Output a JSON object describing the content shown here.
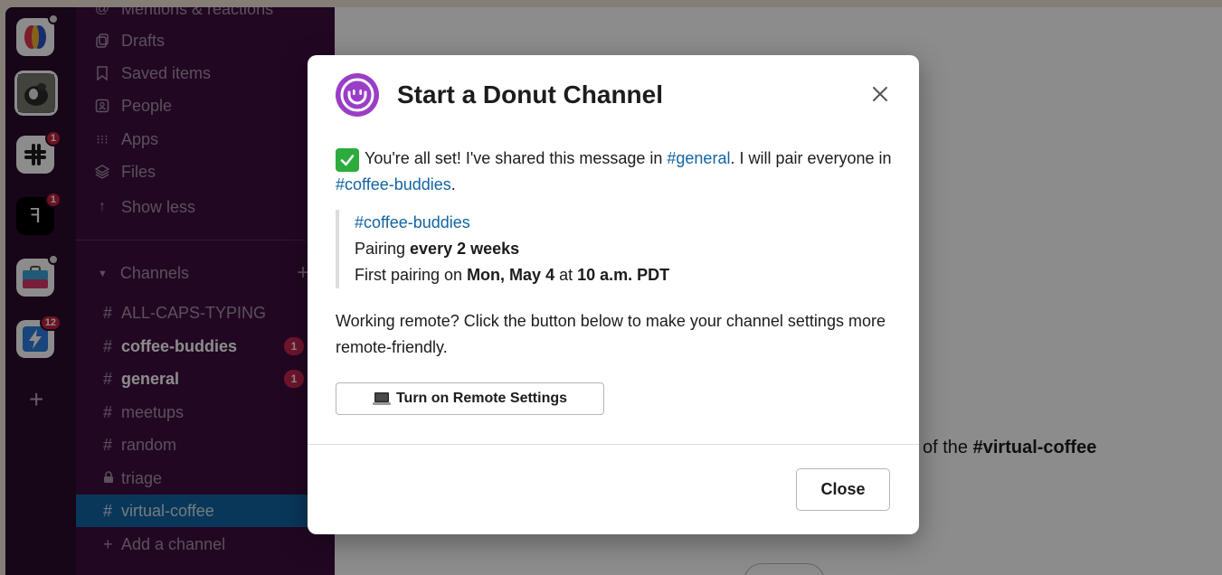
{
  "rail": {
    "workspaces": [
      {
        "name": "workspace-1",
        "badge": ""
      },
      {
        "name": "workspace-2",
        "badge": ""
      },
      {
        "name": "slack",
        "badge": "1"
      },
      {
        "name": "figma",
        "badge": "1"
      },
      {
        "name": "toolbox",
        "badge": ""
      },
      {
        "name": "bolt",
        "badge": "12"
      }
    ],
    "add_icon": "plus-icon"
  },
  "sidebar": {
    "nav": [
      {
        "label": "Mentions & reactions",
        "icon": "at-icon"
      },
      {
        "label": "Drafts",
        "icon": "drafts-icon"
      },
      {
        "label": "Saved items",
        "icon": "bookmark-icon"
      },
      {
        "label": "People",
        "icon": "people-icon"
      },
      {
        "label": "Apps",
        "icon": "apps-icon"
      },
      {
        "label": "Files",
        "icon": "files-icon"
      },
      {
        "label": "Show less",
        "icon": "arrow-up-icon"
      }
    ],
    "channels_label": "Channels",
    "channels": [
      {
        "prefix": "#",
        "name": "ALL-CAPS-TYPING",
        "badge": ""
      },
      {
        "prefix": "#",
        "name": "coffee-buddies",
        "badge": "1"
      },
      {
        "prefix": "#",
        "name": "general",
        "badge": "1"
      },
      {
        "prefix": "#",
        "name": "meetups",
        "badge": ""
      },
      {
        "prefix": "#",
        "name": "random",
        "badge": ""
      },
      {
        "prefix": "lock",
        "name": "triage",
        "badge": ""
      },
      {
        "prefix": "#",
        "name": "virtual-coffee",
        "badge": ""
      }
    ],
    "add_channel": "Add a channel"
  },
  "main": {
    "partial_text_prefix": "of the ",
    "partial_text_channel": "#virtual-coffee"
  },
  "modal": {
    "title": "Start a Donut Channel",
    "msg_part1": "You're all set! I've shared this message in ",
    "msg_link1": "#general",
    "msg_part2": ". I will pair everyone in ",
    "msg_link2": "#coffee-buddies",
    "msg_part3": ".",
    "quote_channel": "#coffee-buddies",
    "quote_pairing_prefix": "Pairing ",
    "quote_pairing_value": "every 2 weeks",
    "quote_first_prefix": "First pairing on ",
    "quote_first_date": "Mon, May 4",
    "quote_first_mid": " at ",
    "quote_first_time": "10 a.m. PDT",
    "remote_text": "Working remote? Click the button below to make your channel settings more remote-friendly.",
    "remote_button": "Turn on Remote Settings",
    "close_button": "Close",
    "colors": {
      "accent": "#9b3ec7",
      "link": "#1264a3",
      "check": "#2bac3c"
    }
  }
}
